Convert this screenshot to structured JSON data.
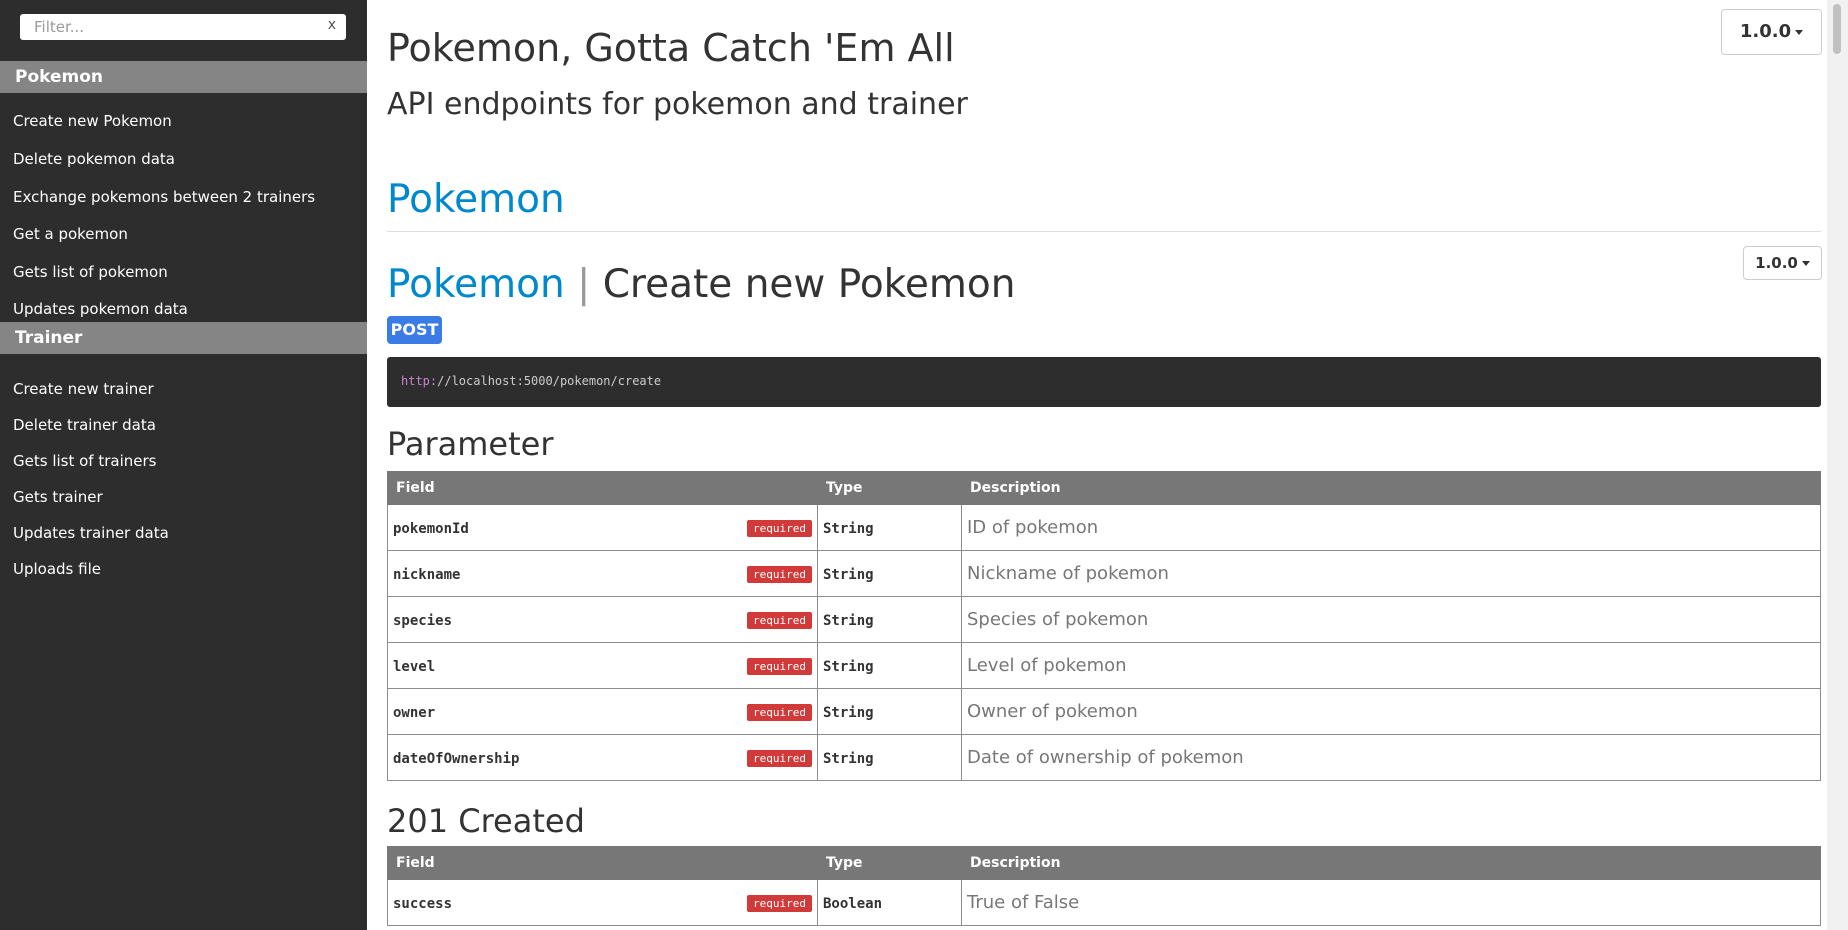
{
  "sidebar": {
    "filter_placeholder": "Filter...",
    "filter_clear": "x",
    "groups": [
      {
        "title": "Pokemon",
        "items": [
          "Create new Pokemon",
          "Delete pokemon data",
          "Exchange pokemons between 2 trainers",
          "Get a pokemon",
          "Gets list of pokemon",
          "Updates pokemon data"
        ]
      },
      {
        "title": "Trainer",
        "items": [
          "Create new trainer",
          "Delete trainer data",
          "Gets list of trainers",
          "Gets trainer",
          "Updates trainer data",
          "Uploads file"
        ]
      }
    ]
  },
  "header": {
    "title": "Pokemon, Gotta Catch 'Em All",
    "subtitle": "API endpoints for pokemon and trainer",
    "version": "1.0.0"
  },
  "section": {
    "title": "Pokemon"
  },
  "endpoint": {
    "group": "Pokemon",
    "separator": "|",
    "name": "Create new Pokemon",
    "version": "1.0.0",
    "method": "POST",
    "method_color": "#3a7be5",
    "url_scheme": "http:",
    "url_rest": "//localhost:5000/pokemon/create",
    "parameter_heading": "Parameter",
    "columns": [
      "Field",
      "Type",
      "Description"
    ],
    "parameters": [
      {
        "field": "pokemonId",
        "required": "required",
        "type": "String",
        "description": "ID of pokemon"
      },
      {
        "field": "nickname",
        "required": "required",
        "type": "String",
        "description": "Nickname of pokemon"
      },
      {
        "field": "species",
        "required": "required",
        "type": "String",
        "description": "Species of pokemon"
      },
      {
        "field": "level",
        "required": "required",
        "type": "String",
        "description": "Level of pokemon"
      },
      {
        "field": "owner",
        "required": "required",
        "type": "String",
        "description": "Owner of pokemon"
      },
      {
        "field": "dateOfOwnership",
        "required": "required",
        "type": "String",
        "description": "Date of ownership of pokemon"
      }
    ],
    "response_heading": "201 Created",
    "response_fields": [
      {
        "field": "success",
        "required": "required",
        "type": "Boolean",
        "description": "True of False"
      }
    ]
  },
  "colors": {
    "sidebar_bg": "#2d2d2d",
    "nav_header_bg": "#858585",
    "link_blue": "#0088cc",
    "required_badge": "#d23a3a"
  }
}
